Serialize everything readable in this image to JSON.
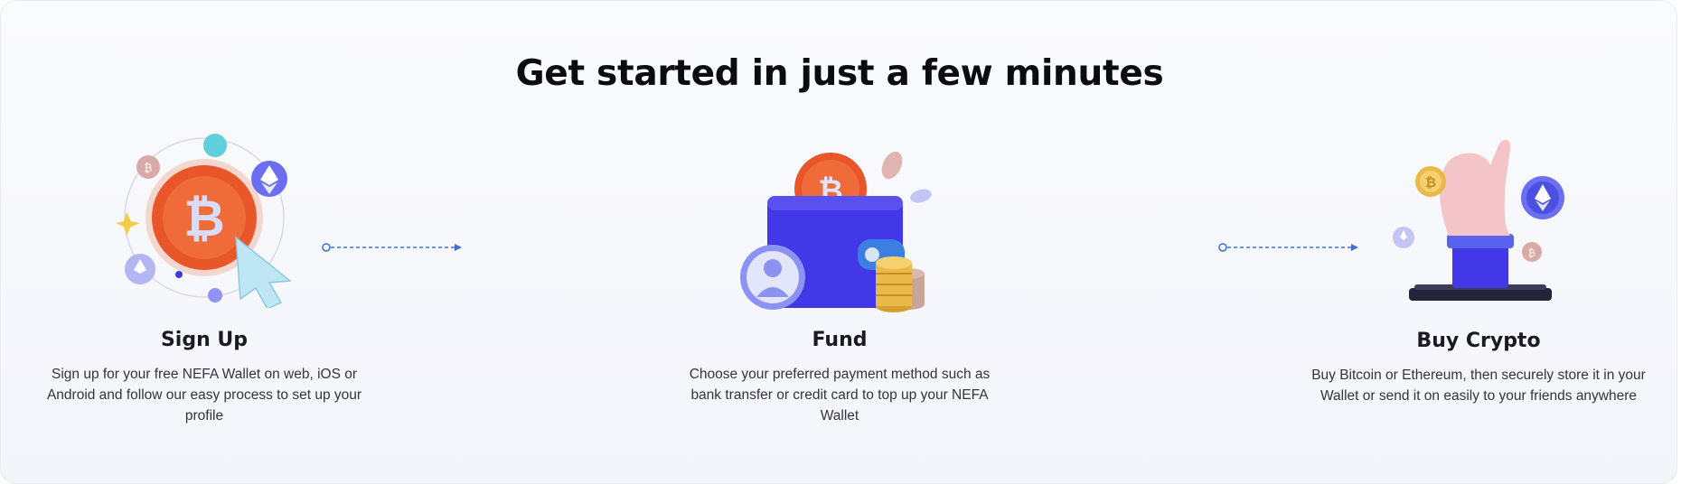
{
  "section": {
    "title": "Get started in just a few minutes"
  },
  "steps": [
    {
      "title": "Sign Up",
      "description": "Sign up for your free NEFA Wallet on web, iOS or Android and follow our easy process to set up your profile"
    },
    {
      "title": "Fund",
      "description": "Choose your preferred payment method such as bank transfer or credit card to top up your NEFA Wallet"
    },
    {
      "title": "Buy Crypto",
      "description": "Buy Bitcoin or Ethereum, then securely store it in your Wallet or send it on easily to your friends anywhere"
    }
  ],
  "colors": {
    "accent": "#3b6fe0",
    "bitcoin_orange": "#e8562a",
    "wallet_blue": "#4338e8",
    "coin_gold": "#e9b949"
  },
  "icons": [
    "bitcoin-orbit-icon",
    "cursor-icon",
    "wallet-icon",
    "user-avatar-icon",
    "coin-stack-icon",
    "hand-coin-icon",
    "ethereum-icon",
    "arrow-right-icon"
  ]
}
